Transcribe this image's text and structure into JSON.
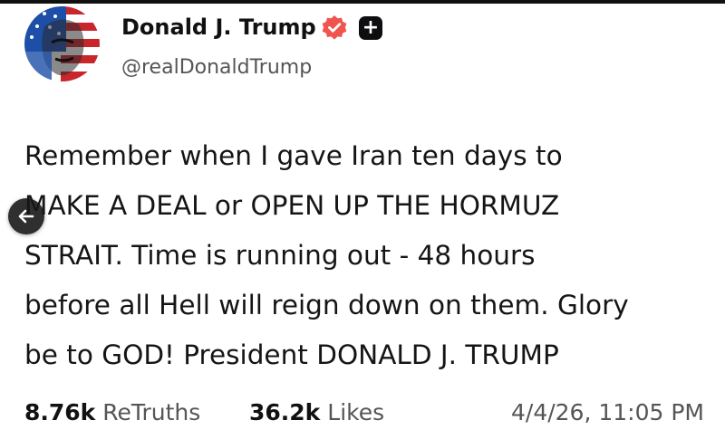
{
  "author": {
    "display_name": "Donald J. Trump",
    "handle": "@realDonaldTrump",
    "verified_icon": "verified-badge-icon",
    "verified_color": "#f0544f",
    "plus_badge_symbol": "+"
  },
  "post": {
    "lines": [
      "Remember when I gave Iran ten days to",
      "MAKE A DEAL or OPEN UP THE HORMUZ",
      "STRAIT. Time is running out - 48 hours",
      "before all Hell will reign down on them. Glory",
      "be to GOD! President DONALD J. TRUMP"
    ]
  },
  "stats": {
    "retruths_count": "8.76k",
    "retruths_label": "ReTruths",
    "likes_count": "36.2k",
    "likes_label": "Likes",
    "timestamp": "4/4/26, 11:05 PM"
  },
  "navigation": {
    "back_icon": "arrow-left-icon"
  }
}
